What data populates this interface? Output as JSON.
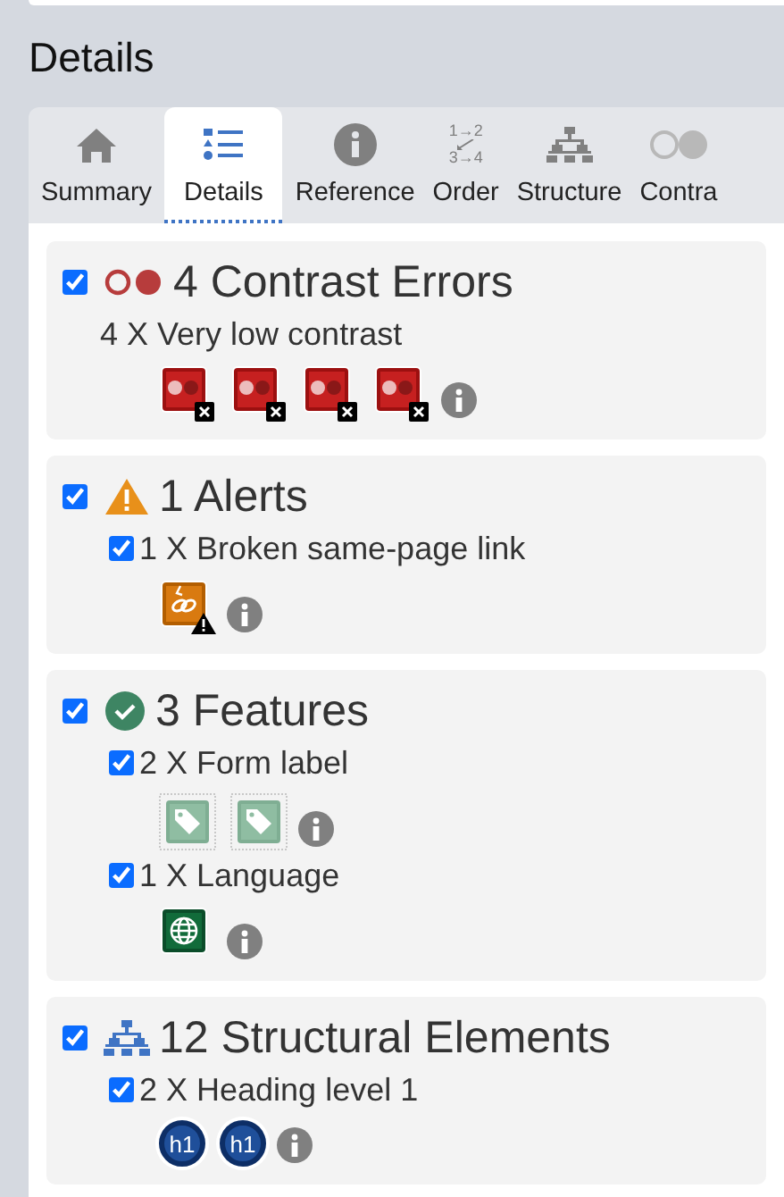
{
  "heading": "Details",
  "tabs": [
    {
      "kind": "summary",
      "label": "Summary",
      "selected": false
    },
    {
      "kind": "details",
      "label": "Details",
      "selected": true
    },
    {
      "kind": "reference",
      "label": "Reference",
      "selected": false
    },
    {
      "kind": "order",
      "label": "Order",
      "selected": false,
      "icon_lines": [
        "1→2",
        "3→4"
      ]
    },
    {
      "kind": "structure",
      "label": "Structure",
      "selected": false
    },
    {
      "kind": "contrast",
      "label": "Contra",
      "selected": false
    }
  ],
  "sections": [
    {
      "kind": "contrast",
      "checked": true,
      "title": "4 Contrast Errors",
      "items": [
        {
          "label": "4 X Very low contrast",
          "icons": [
            {
              "kind": "contrast-error"
            },
            {
              "kind": "contrast-error"
            },
            {
              "kind": "contrast-error"
            },
            {
              "kind": "contrast-error"
            }
          ]
        }
      ]
    },
    {
      "kind": "alert",
      "checked": true,
      "title": "1 Alerts",
      "items": [
        {
          "label": "1 X Broken same-page link",
          "checked": true,
          "icons": [
            {
              "kind": "broken-link"
            }
          ]
        }
      ]
    },
    {
      "kind": "feature",
      "checked": true,
      "title": "3 Features",
      "items": [
        {
          "label": "2 X Form label",
          "checked": true,
          "icons": [
            {
              "kind": "tag"
            },
            {
              "kind": "tag"
            }
          ]
        },
        {
          "label": "1 X Language",
          "checked": true,
          "icons": [
            {
              "kind": "globe"
            }
          ]
        }
      ]
    },
    {
      "kind": "structure",
      "checked": true,
      "title": "12 Structural Elements",
      "items": [
        {
          "label": "2 X Heading level 1",
          "checked": true,
          "icons": [
            {
              "kind": "heading",
              "text": "h1"
            },
            {
              "kind": "heading",
              "text": "h1"
            }
          ]
        }
      ]
    }
  ]
}
